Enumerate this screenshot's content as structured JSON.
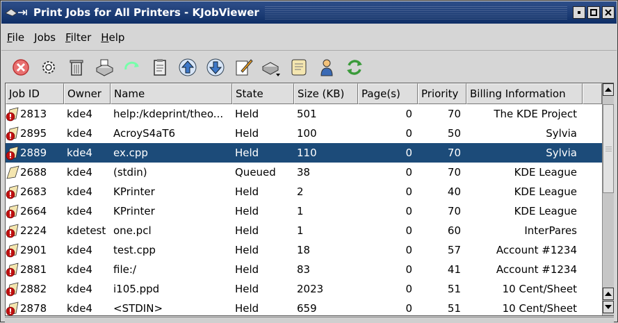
{
  "window": {
    "title": "Print Jobs for All Printers - KJobViewer"
  },
  "menubar": [
    {
      "label": "File",
      "mnemonic": "F",
      "rest": "ile"
    },
    {
      "label": "Jobs",
      "mnemonic": "J",
      "rest": "obs"
    },
    {
      "label": "Filter",
      "mnemonic": "F",
      "rest": "ilter"
    },
    {
      "label": "Help",
      "mnemonic": "H",
      "rest": "elp"
    }
  ],
  "toolbar": [
    {
      "name": "cancel-job",
      "icon": "stop-icon"
    },
    {
      "name": "job-settings",
      "icon": "gear-icon"
    },
    {
      "name": "remove-job",
      "icon": "trash-icon"
    },
    {
      "name": "move-to-printer",
      "icon": "printer-icon"
    },
    {
      "name": "restart-job",
      "icon": "redo-icon"
    },
    {
      "name": "job-ipp-report",
      "icon": "clipboard-icon"
    },
    {
      "name": "increase-priority",
      "icon": "arrow-up-icon"
    },
    {
      "name": "decrease-priority",
      "icon": "arrow-down-icon"
    },
    {
      "name": "edit-attributes",
      "icon": "edit-icon"
    },
    {
      "name": "printer-select",
      "icon": "printer-dropdown-icon"
    },
    {
      "name": "job-history",
      "icon": "scroll-icon"
    },
    {
      "name": "user-filter",
      "icon": "user-icon"
    },
    {
      "name": "refresh",
      "icon": "refresh-icon"
    }
  ],
  "table": {
    "columns": [
      "Job ID",
      "Owner",
      "Name",
      "State",
      "Size (KB)",
      "Page(s)",
      "Priority",
      "Billing Information"
    ],
    "rows": [
      {
        "id": "2813",
        "owner": "kde4",
        "name": "help:/kdeprint/theo...",
        "state": "Held",
        "size": "501",
        "pages": "0",
        "priority": "70",
        "billing": "The KDE Project",
        "status": "held"
      },
      {
        "id": "2895",
        "owner": "kde4",
        "name": "AcroyS4aT6",
        "state": "Held",
        "size": "100",
        "pages": "0",
        "priority": "50",
        "billing": "Sylvia",
        "status": "held"
      },
      {
        "id": "2889",
        "owner": "kde4",
        "name": "ex.cpp",
        "state": "Held",
        "size": "110",
        "pages": "0",
        "priority": "70",
        "billing": "Sylvia",
        "status": "held"
      },
      {
        "id": "2688",
        "owner": "kde4",
        "name": "(stdin)",
        "state": "Queued",
        "size": "38",
        "pages": "0",
        "priority": "70",
        "billing": "KDE League",
        "status": "queued"
      },
      {
        "id": "2683",
        "owner": "kde4",
        "name": "KPrinter",
        "state": "Held",
        "size": "2",
        "pages": "0",
        "priority": "40",
        "billing": "KDE League",
        "status": "held"
      },
      {
        "id": "2664",
        "owner": "kde4",
        "name": "KPrinter",
        "state": "Held",
        "size": "1",
        "pages": "0",
        "priority": "70",
        "billing": "KDE League",
        "status": "held"
      },
      {
        "id": "2224",
        "owner": "kdetest",
        "name": "one.pcl",
        "state": "Held",
        "size": "1",
        "pages": "0",
        "priority": "60",
        "billing": "InterPares",
        "status": "held"
      },
      {
        "id": "2901",
        "owner": "kde4",
        "name": "test.cpp",
        "state": "Held",
        "size": "18",
        "pages": "0",
        "priority": "57",
        "billing": "Account #1234",
        "status": "held"
      },
      {
        "id": "2881",
        "owner": "kde4",
        "name": "file:/",
        "state": "Held",
        "size": "83",
        "pages": "0",
        "priority": "41",
        "billing": "Account #1234",
        "status": "held"
      },
      {
        "id": "2882",
        "owner": "kde4",
        "name": "i105.ppd",
        "state": "Held",
        "size": "2023",
        "pages": "0",
        "priority": "51",
        "billing": "10 Cent/Sheet",
        "status": "held"
      },
      {
        "id": "2878",
        "owner": "kde4",
        "name": "<STDIN>",
        "state": "Held",
        "size": "659",
        "pages": "0",
        "priority": "51",
        "billing": "10 Cent/Sheet",
        "status": "held"
      }
    ],
    "selected_index": 2
  },
  "colors": {
    "titlebar": "#1e3f78",
    "selection": "#1c4b79",
    "held_badge": "#c01010"
  }
}
